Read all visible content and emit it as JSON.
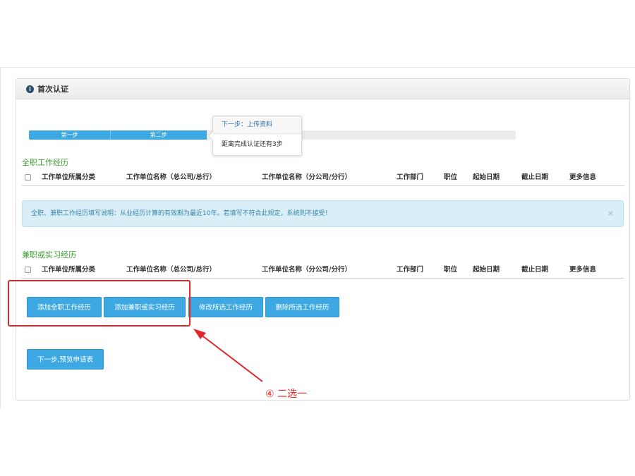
{
  "panel": {
    "title": "首次认证",
    "title_icon": "info-circle-icon"
  },
  "progress": {
    "steps": [
      "第一步",
      "第二步"
    ],
    "completed_fraction": 0.365,
    "accent": "#3ea8e2"
  },
  "tooltip": {
    "title": "下一步：上传资料",
    "body": "距离完成认证还有3步"
  },
  "fulltime": {
    "title": "全职工作经历",
    "columns": [
      "工作单位所属分类",
      "工作单位名称（总公司/总行）",
      "工作单位名称（分公司/分行）",
      "工作部门",
      "职位",
      "起始日期",
      "截止日期",
      "更多信息"
    ]
  },
  "alert": {
    "text": "全职、兼职工作经历填写说明：从业经历计算的有效期为最近10年。若填写不符合此规定，系统则不接受！",
    "close": "×"
  },
  "parttime": {
    "title": "兼职或实习经历",
    "columns": [
      "工作单位所属分类",
      "工作单位名称（总公司/总行）",
      "工作单位名称（分公司/分行）",
      "工作部门",
      "职位",
      "起始日期",
      "截止日期",
      "更多信息"
    ]
  },
  "buttons": {
    "add_fulltime": "添加全职工作经历",
    "add_parttime": "添加兼职或实习经历",
    "edit_selected": "修改所选工作经历",
    "delete_selected": "删除所选工作经历",
    "next": "下一步,预览申请表"
  },
  "annotation": {
    "text": "④ 二选一",
    "color": "#e3262a"
  }
}
